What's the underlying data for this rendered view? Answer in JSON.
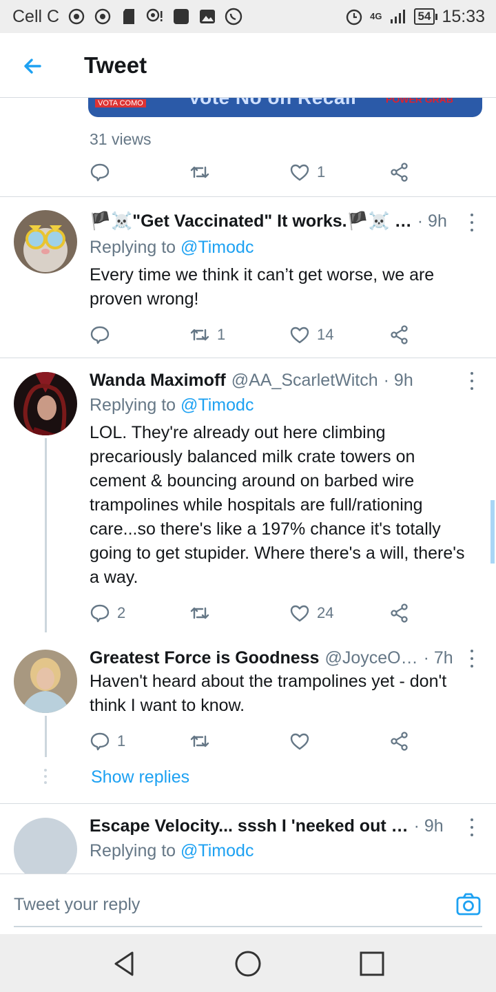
{
  "status_bar": {
    "carrier": "Cell C",
    "network": "4G",
    "battery": "54",
    "time": "15:33"
  },
  "header": {
    "title": "Tweet"
  },
  "main_tweet": {
    "media_text": "Vote No on Recall",
    "media_subtext": "POWER GRAB",
    "media_corner": "VOTA COMO",
    "views": "31 views",
    "likes": "1"
  },
  "replies": [
    {
      "name": "🏴☠️\"Get Vaccinated\" It works.🏴☠️ …",
      "handle": "",
      "time": "· 9h",
      "replying_prefix": "Replying to",
      "replying_to": "@Timodc",
      "text": "Every time we think it can’t get worse, we are proven wrong!",
      "replies_count": "",
      "retweets": "1",
      "likes": "14"
    },
    {
      "name": "Wanda Maximoff",
      "handle": "@AA_ScarletWitch",
      "time": "· 9h",
      "replying_prefix": "Replying to",
      "replying_to": "@Timodc",
      "text": "LOL. They're already out here climbing precariously balanced milk crate towers on cement & bouncing around on barbed wire trampolines while hospitals are full/rationing care...so there's like a 197% chance it's totally going to get stupider. Where there's a will, there's a way.",
      "replies_count": "2",
      "retweets": "",
      "likes": "24"
    },
    {
      "name": "Greatest Force is Goodness",
      "handle": "@JoyceO…",
      "time": "· 7h",
      "text": "Haven't heard about the trampolines yet - don't think I want to know.",
      "replies_count": "1",
      "retweets": "",
      "likes": "",
      "show_replies": "Show replies"
    },
    {
      "name": "Escape Velocity... sssh I 'neeked out …",
      "handle": "",
      "time": "· 9h",
      "replying_prefix": "Replying to",
      "replying_to": "@Timodc"
    }
  ],
  "reply_bar": {
    "placeholder": "Tweet your reply"
  },
  "colors": {
    "accent": "#1da1f2",
    "secondary_text": "#657786",
    "primary_text": "#14171a",
    "divider": "#d6dbe0"
  },
  "icons": [
    "back-arrow-icon",
    "reply-icon",
    "retweet-icon",
    "like-icon",
    "share-icon",
    "more-icon",
    "camera-icon",
    "nav-back-icon",
    "nav-home-icon",
    "nav-recents-icon"
  ]
}
